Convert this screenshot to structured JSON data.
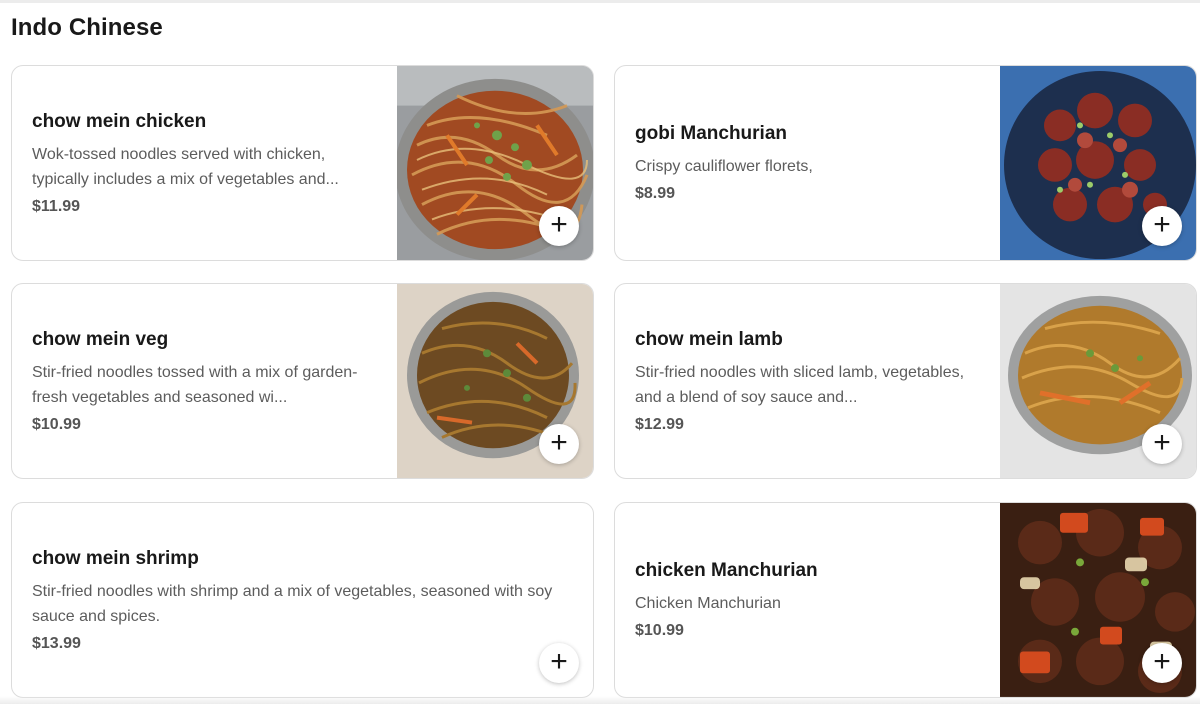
{
  "section": {
    "title": "Indo Chinese"
  },
  "add_label": "+",
  "items": [
    {
      "name": "chow mein chicken",
      "description": "Wok-tossed noodles served with chicken, typically includes a mix of vegetables and...",
      "price": "$11.99",
      "image": "noodles-chicken"
    },
    {
      "name": "gobi Manchurian",
      "description": "Crispy cauliflower florets,",
      "price": "$8.99",
      "image": "gobi-manchurian"
    },
    {
      "name": "chow mein veg",
      "description": "Stir-fried noodles tossed with a mix of garden-fresh vegetables and seasoned wi...",
      "price": "$10.99",
      "image": "noodles-veg"
    },
    {
      "name": "chow mein lamb",
      "description": "Stir-fried noodles with sliced lamb, vegetables, and a blend of soy sauce and...",
      "price": "$12.99",
      "image": "noodles-lamb"
    },
    {
      "name": "chow mein shrimp",
      "description": "Stir-fried noodles with shrimp and a mix of vegetables, seasoned with soy sauce and spices.",
      "price": "$13.99",
      "image": ""
    },
    {
      "name": "chicken Manchurian",
      "description": "Chicken Manchurian",
      "price": "$10.99",
      "image": "chicken-manchurian"
    }
  ]
}
